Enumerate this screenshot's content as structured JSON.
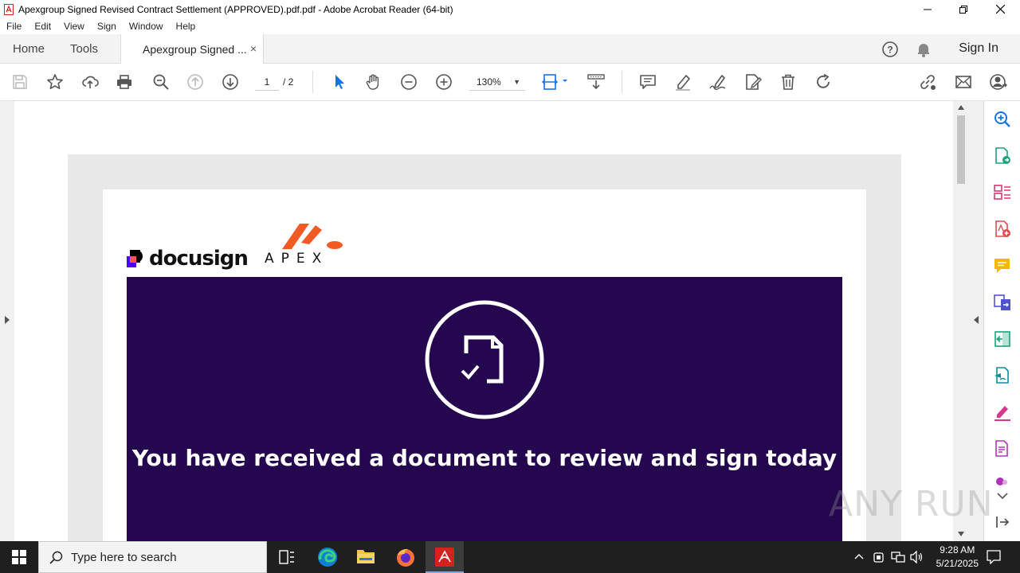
{
  "window": {
    "title": "Apexgroup Signed Revised Contract Settlement (APPROVED).pdf.pdf - Adobe Acrobat Reader (64-bit)"
  },
  "menu": [
    "File",
    "Edit",
    "View",
    "Sign",
    "Window",
    "Help"
  ],
  "tabs": {
    "home": "Home",
    "tools": "Tools",
    "doc": "Apexgroup Signed ...",
    "close": "×",
    "sign_in": "Sign In"
  },
  "toolbar": {
    "page_current": "1",
    "page_total": "/ 2",
    "zoom": "130%"
  },
  "document": {
    "logo_docusign": "docusign",
    "logo_apex": "APEX",
    "headline": "You have received a document to review and sign today"
  },
  "taskbar": {
    "search_placeholder": "Type here to search",
    "time": "9:28 AM",
    "date": "5/21/2025"
  },
  "watermark": "ANY RUN",
  "colors": {
    "banner": "#24074f",
    "acrobat_red": "#d4231e",
    "select_blue": "#1473e6",
    "apex_orange": "#f15a22"
  }
}
